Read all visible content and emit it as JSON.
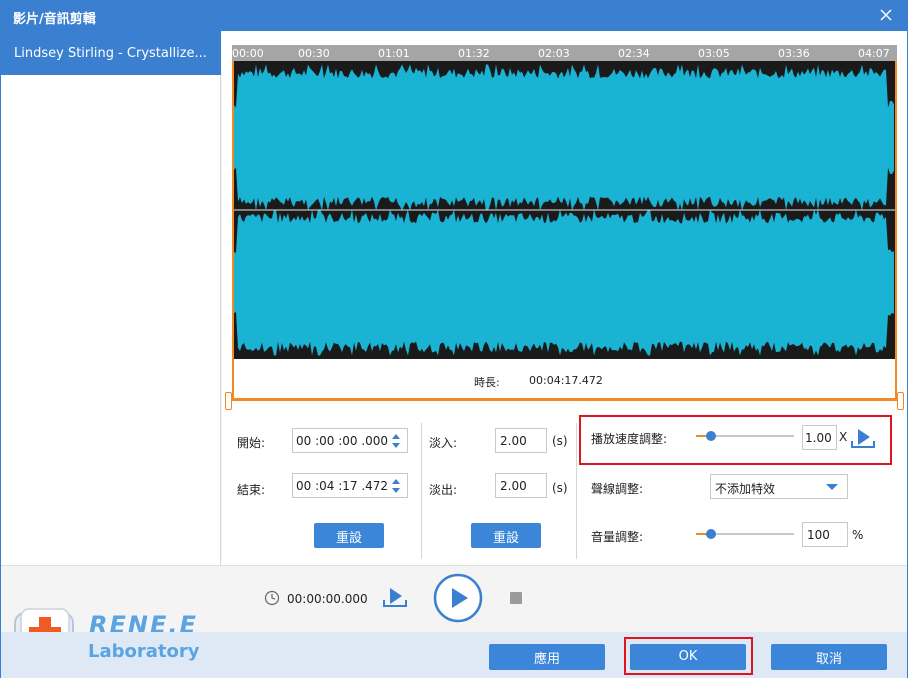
{
  "window": {
    "title": "影片/音訊剪輯",
    "close_icon": "close-icon"
  },
  "sidebar": {
    "items": [
      {
        "label": "Lindsey Stirling - Crystallize..."
      }
    ]
  },
  "timeline": {
    "ticks": [
      "00:00",
      "00:30",
      "01:01",
      "01:32",
      "02:03",
      "02:34",
      "03:05",
      "03:36",
      "04:07"
    ]
  },
  "waveform": {
    "duration_label": "時長:",
    "duration_value": "00:04:17.472",
    "wave_color": "#1ab3d4",
    "trim_color": "#f08a23"
  },
  "trim": {
    "start_label": "開始:",
    "start_value": "00 :00 :00 .000",
    "end_label": "結束:",
    "end_value": "00 :04 :17 .472",
    "reset_label": "重設"
  },
  "fade": {
    "in_label": "淡入:",
    "in_value": "2.00",
    "out_label": "淡出:",
    "out_value": "2.00",
    "unit": "(s)",
    "reset_label": "重設"
  },
  "adjust": {
    "speed_label": "播放速度調整:",
    "speed_value": "1.00",
    "speed_unit": "X",
    "speed_level": 0.15,
    "echo_label": "聲線調整:",
    "echo_option": "不添加特效",
    "volume_label": "音量調整:",
    "volume_value": "100",
    "volume_unit": "%",
    "volume_level": 0.15
  },
  "player": {
    "time": "00:00:00.000"
  },
  "footer": {
    "logo_title": "RENE.E",
    "logo_subtitle": "Laboratory",
    "apply_label": "應用",
    "ok_label": "OK",
    "cancel_label": "取消"
  },
  "colors": {
    "accent": "#3b7fd0",
    "button": "#3b86d8",
    "highlight": "#e0141e",
    "orange": "#f08a23"
  }
}
